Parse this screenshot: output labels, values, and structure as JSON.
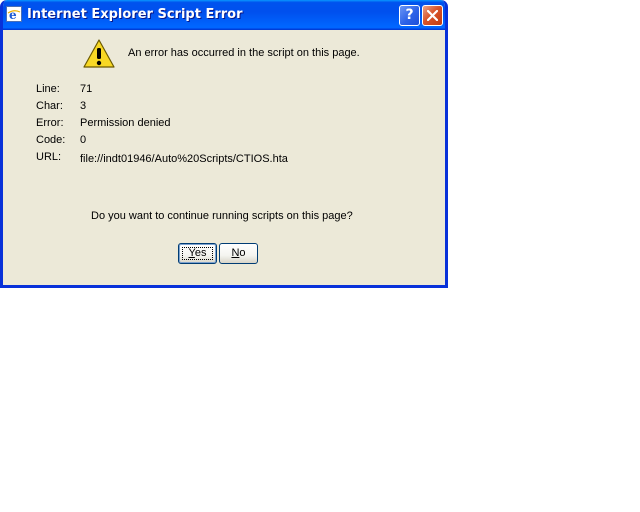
{
  "window": {
    "title": "Internet Explorer Script Error",
    "help_label": "?"
  },
  "message": "An error has occurred in the script on this page.",
  "details": [
    {
      "label": "Line:",
      "value": "71"
    },
    {
      "label": "Char:",
      "value": "3"
    },
    {
      "label": "Error:",
      "value": "Permission denied"
    },
    {
      "label": "Code:",
      "value": "0"
    },
    {
      "label": "URL:",
      "value": "file://indt01946/Auto%20Scripts/CTIOS.hta"
    }
  ],
  "question": "Do you want to continue running scripts on this page?",
  "buttons": {
    "yes": {
      "mnemonic": "Y",
      "rest": "es"
    },
    "no": {
      "mnemonic": "N",
      "rest": "o"
    }
  },
  "colors": {
    "titlebar": "#0053ee",
    "dialog_bg": "#ece9d8",
    "warning": "#f8d825",
    "close": "#d9542a"
  }
}
